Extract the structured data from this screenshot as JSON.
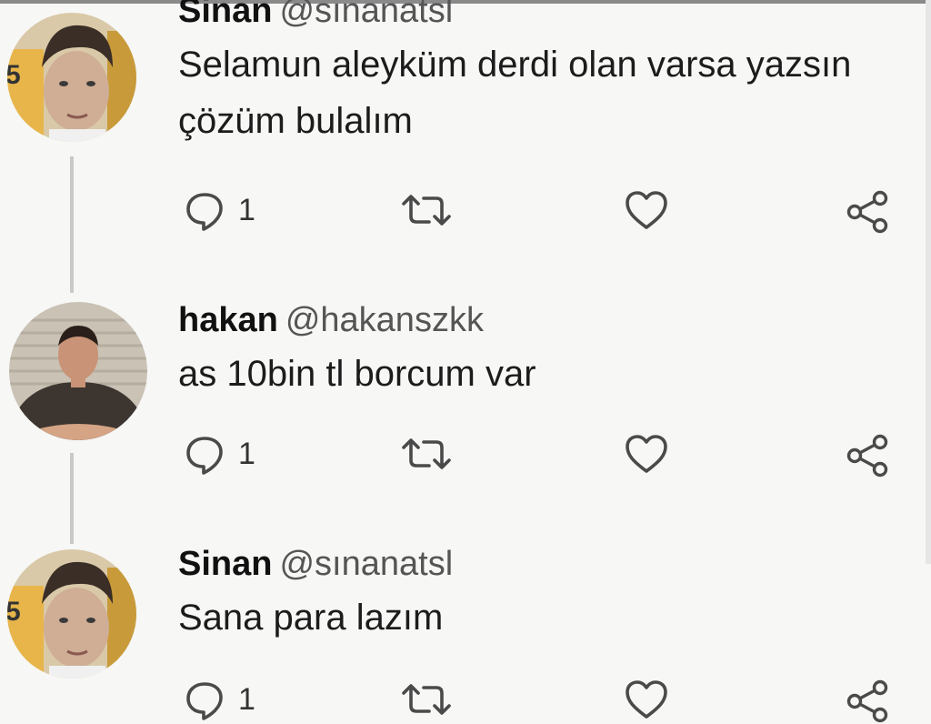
{
  "colors": {
    "background": "#f7f7f5",
    "text": "#1a1a1a",
    "handle": "#555555",
    "icon": "#4a4a4a"
  },
  "tweets": [
    {
      "name": "Sinan",
      "handle": "@sınanatsl",
      "text": "Selamun aleyküm derdi olan varsa yazsın\nçözüm bulalım",
      "reply_count": "1",
      "avatar": "sinan-avatar"
    },
    {
      "name": "hakan",
      "handle": "@hakanszkk",
      "text": "as 10bin tl borcum var",
      "reply_count": "1",
      "avatar": "hakan-avatar"
    },
    {
      "name": "Sinan",
      "handle": "@sınanatsl",
      "text": "Sana para lazım",
      "reply_count": "1",
      "avatar": "sinan-avatar"
    }
  ],
  "icons": {
    "reply": "comment-icon",
    "retweet": "retweet-icon",
    "like": "heart-icon",
    "share": "share-icon"
  }
}
